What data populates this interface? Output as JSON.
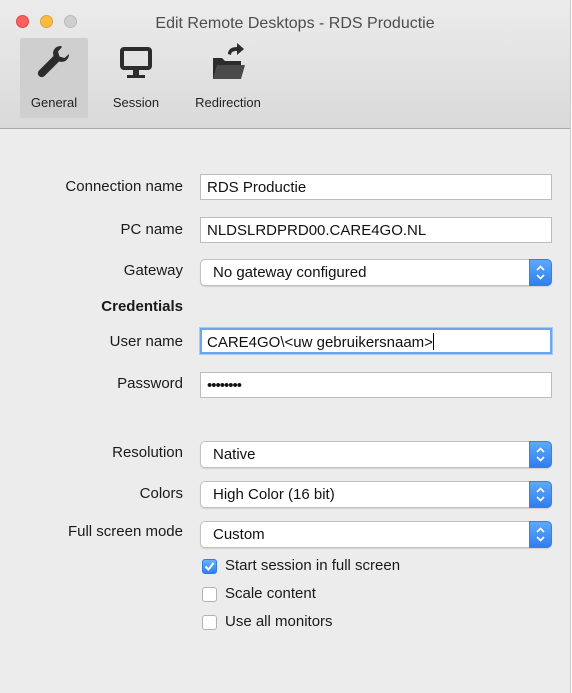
{
  "window": {
    "title": "Edit Remote Desktops - RDS Productie"
  },
  "toolbar": {
    "tabs": [
      {
        "label": "General",
        "icon": "wrench-icon",
        "selected": true
      },
      {
        "label": "Session",
        "icon": "monitor-icon",
        "selected": false
      },
      {
        "label": "Redirection",
        "icon": "folder-redirect-icon",
        "selected": false
      }
    ]
  },
  "form": {
    "connection_name": {
      "label": "Connection name",
      "value": "RDS Productie"
    },
    "pc_name": {
      "label": "PC name",
      "value": "NLDSLRDPRD00.CARE4GO.NL"
    },
    "gateway": {
      "label": "Gateway",
      "value": "No gateway configured"
    },
    "credentials_heading": "Credentials",
    "user_name": {
      "label": "User name",
      "value": "CARE4GO\\<uw gebruikersnaam>"
    },
    "password": {
      "label": "Password",
      "value": "••••••••"
    },
    "resolution": {
      "label": "Resolution",
      "value": "Native"
    },
    "colors": {
      "label": "Colors",
      "value": "High Color (16 bit)"
    },
    "full_screen_mode": {
      "label": "Full screen mode",
      "value": "Custom"
    },
    "checkboxes": [
      {
        "label": "Start session in full screen",
        "checked": true
      },
      {
        "label": "Scale content",
        "checked": false
      },
      {
        "label": "Use all monitors",
        "checked": false
      }
    ]
  },
  "colors": {
    "accent_blue": "#2f7ef1",
    "close": "#fc605c",
    "minimize": "#fdbc40"
  }
}
